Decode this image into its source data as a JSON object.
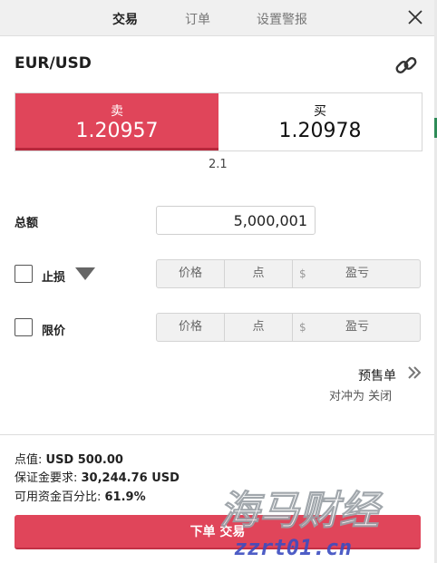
{
  "header": {
    "tabs": [
      {
        "label": "交易",
        "active": true
      },
      {
        "label": "订单",
        "active": false
      },
      {
        "label": "设置警报",
        "active": false
      }
    ]
  },
  "instrument": {
    "pair": "EUR/USD"
  },
  "quote": {
    "sell_label": "卖",
    "sell_price": "1.20957",
    "buy_label": "买",
    "buy_price": "1.20978",
    "spread": "2.1"
  },
  "amount": {
    "label": "总额",
    "value": "5,000,001"
  },
  "stop_loss": {
    "label": "止损",
    "price_placeholder": "价格",
    "points_placeholder": "点",
    "currency_symbol": "$",
    "pl_placeholder": "盈亏"
  },
  "limit": {
    "label": "限价",
    "price_placeholder": "价格",
    "points_placeholder": "点",
    "currency_symbol": "$",
    "pl_placeholder": "盈亏"
  },
  "preorder": {
    "label": "预售单",
    "hedge": "对冲为 关闭"
  },
  "info": {
    "pip_value_label": "点值: ",
    "pip_value": "USD 500.00",
    "margin_label": "保证金要求: ",
    "margin": "30,244.76 USD",
    "available_label": "可用资金百分比: ",
    "available": "61.9%"
  },
  "submit": {
    "label": "下单 交易"
  },
  "watermark": {
    "line1": "海马财经",
    "line2": "zzrt01.cn"
  },
  "colors": {
    "sell": "#e0455a",
    "accent_green": "#2e8b57"
  },
  "icons": {
    "close": "close-icon",
    "link": "link-icon",
    "caret": "caret-down-icon",
    "chevron": "double-chevron-right-icon"
  }
}
